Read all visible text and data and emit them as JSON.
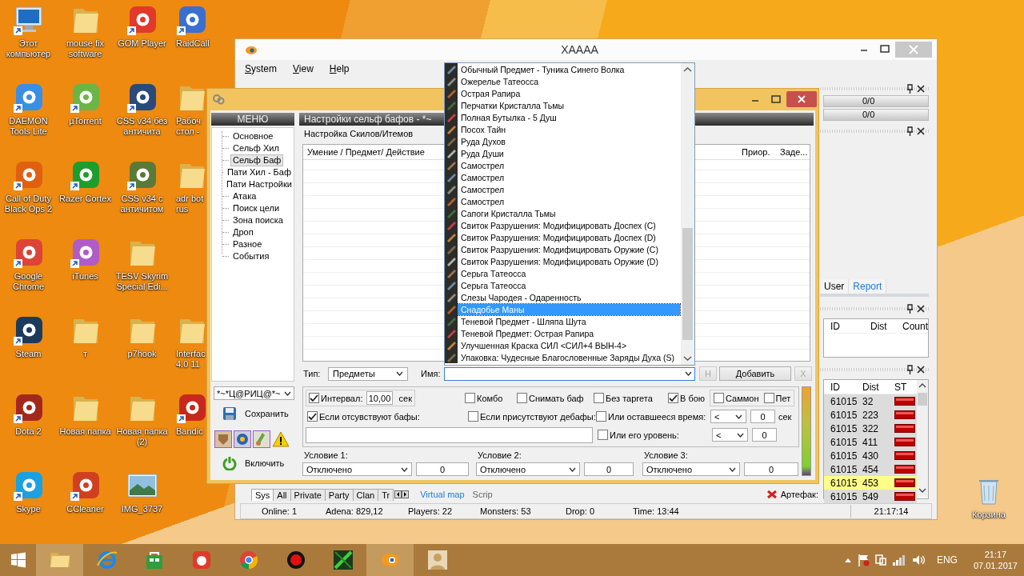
{
  "desktop": {
    "rows": [
      [
        {
          "label": "Этот компьютер",
          "kind": "computer"
        },
        {
          "label": "mouse fix software",
          "kind": "folder"
        },
        {
          "label": "GOM Player",
          "kind": "app",
          "color": "#e2392a"
        },
        {
          "label": "RaidCall",
          "kind": "app",
          "color": "#3a6fd0"
        }
      ],
      [
        {
          "label": "DAEMON Tools Lite",
          "kind": "app",
          "color": "#3a8ee6"
        },
        {
          "label": "µTorrent",
          "kind": "app",
          "color": "#6bb544"
        },
        {
          "label": "CSS v34 без античита",
          "kind": "app",
          "color": "#2a4a7a"
        },
        {
          "label": "Рабоч стол -",
          "kind": "folder"
        }
      ],
      [
        {
          "label": "Call of Duty Black Ops 2",
          "kind": "app",
          "color": "#e06010"
        },
        {
          "label": "Razer Cortex",
          "kind": "app",
          "color": "#1f9c2e"
        },
        {
          "label": "CSS v34 с античитом",
          "kind": "app",
          "color": "#5a7a3a"
        },
        {
          "label": "adr bot rus",
          "kind": "folder"
        }
      ],
      [
        {
          "label": "Google Chrome",
          "kind": "app",
          "color": "#db4437"
        },
        {
          "label": "iTunes",
          "kind": "app",
          "color": "#b05cc8"
        },
        {
          "label": "TESV Skyrim Special Edi...",
          "kind": "folder"
        }
      ],
      [
        {
          "label": "Steam",
          "kind": "app",
          "color": "#1b3a5c"
        },
        {
          "label": "т",
          "kind": "folder"
        },
        {
          "label": "p7hook",
          "kind": "folder"
        },
        {
          "label": "Interfac 4.0 11",
          "kind": "folder"
        }
      ],
      [
        {
          "label": "Dota 2",
          "kind": "app",
          "color": "#a3281c"
        },
        {
          "label": "Новая папка",
          "kind": "folder"
        },
        {
          "label": "Новая папка (2)",
          "kind": "folder"
        },
        {
          "label": "Bandic",
          "kind": "app",
          "color": "#c8281c"
        }
      ],
      [
        {
          "label": "Skype",
          "kind": "app",
          "color": "#1ba1e2"
        },
        {
          "label": "CCleaner",
          "kind": "app",
          "color": "#d04020"
        },
        {
          "label": "IMG_3737",
          "kind": "image"
        }
      ]
    ],
    "recycle_bin": "Корзина"
  },
  "main_window": {
    "title": "XAAAA",
    "menu": [
      "System",
      "View",
      "Help"
    ],
    "bars": [
      "0/0",
      "0/0"
    ],
    "side_tabs": [
      {
        "label": "User",
        "selected": false
      },
      {
        "label": "Report",
        "selected": true
      }
    ],
    "npc_table": {
      "columns": [
        "ID",
        "Dist",
        "Count"
      ]
    },
    "mob_table": {
      "columns": [
        "ID",
        "Dist",
        "ST"
      ],
      "rows": [
        {
          "id": "61015",
          "dist": "32",
          "selected": false
        },
        {
          "id": "61015",
          "dist": "223",
          "selected": false
        },
        {
          "id": "61015",
          "dist": "322",
          "selected": false
        },
        {
          "id": "61015",
          "dist": "411",
          "selected": false
        },
        {
          "id": "61015",
          "dist": "430",
          "selected": false
        },
        {
          "id": "61015",
          "dist": "454",
          "selected": false
        },
        {
          "id": "61015",
          "dist": "453",
          "selected": true
        },
        {
          "id": "61015",
          "dist": "549",
          "selected": false
        }
      ]
    },
    "chat_tabs": [
      {
        "label": "Sys",
        "selected": true
      },
      {
        "label": "All",
        "selected": false
      },
      {
        "label": "Private",
        "selected": false
      },
      {
        "label": "Party",
        "selected": false
      },
      {
        "label": "Clan",
        "selected": false
      },
      {
        "label": "Tr",
        "selected": false
      }
    ],
    "map_tabs": [
      {
        "label": "Virtual map",
        "selected": true
      },
      {
        "label": "Scrip",
        "selected": false
      }
    ],
    "artifact_label": "Артефак:",
    "status_bar": [
      "Online: 1",
      "Adena: 829,12",
      "Players: 22",
      "Monsters: 53",
      "Drop: 0",
      "Time: 13:44",
      "21:17:14"
    ]
  },
  "dialog": {
    "menu_title": "МЕНЮ",
    "nav": [
      {
        "label": "Основное",
        "selected": false
      },
      {
        "label": "Сельф Хил",
        "selected": false
      },
      {
        "label": "Сельф Баф",
        "selected": true
      },
      {
        "label": "Пати Хил - Баф",
        "selected": false
      },
      {
        "label": "Пати Настройки",
        "selected": false
      },
      {
        "label": "Атака",
        "selected": false
      },
      {
        "label": "Поиск цели",
        "selected": false
      },
      {
        "label": "Зона поиска",
        "selected": false
      },
      {
        "label": "Дроп",
        "selected": false
      },
      {
        "label": "Разное",
        "selected": false
      },
      {
        "label": "События",
        "selected": false
      }
    ],
    "profile": "*~*Ц@РИЦ@*~",
    "save": "Сохранить",
    "enable": "Включить",
    "panel_title": "Настройки сельф бафов - *~",
    "group": "Настройка Скилов/Итемов",
    "columns": [
      "Умение / Предмет/ Действие",
      "Приор.",
      "Заде..."
    ],
    "type_label": "Тип:",
    "type_value": "Предметы",
    "name_label": "Имя:",
    "buttons": [
      {
        "label": "Н",
        "disabled": true
      },
      {
        "label": "Добавить",
        "disabled": false
      },
      {
        "label": "X",
        "disabled": true
      }
    ],
    "interval": {
      "label": "Интервал:",
      "checked": true,
      "value": "10,00",
      "unit": "сек"
    },
    "options": [
      {
        "label": "Комбо",
        "checked": false
      },
      {
        "label": "Снимать баф",
        "checked": false
      },
      {
        "label": "Без таргета",
        "checked": false
      },
      {
        "label": "В бою",
        "checked": true
      },
      {
        "label": "Саммон",
        "checked": false
      },
      {
        "label": "Пет",
        "checked": false
      }
    ],
    "buffs_missing": {
      "label": "Если отсувствуют бафы:",
      "checked": true
    },
    "debuffs_present": {
      "label": "Если присутствуют дебафы:",
      "checked": false
    },
    "time_left": {
      "label": "Или оставшееся время:",
      "checked": false,
      "op": "<",
      "value": "0",
      "unit": "сек"
    },
    "its_level": {
      "label": "Или его уровень:",
      "checked": false,
      "op": "<",
      "value": "0"
    },
    "conditions": [
      {
        "label": "Условие 1:",
        "value": "Отключено",
        "number": "0"
      },
      {
        "label": "Условие 2:",
        "value": "Отключено",
        "number": "0"
      },
      {
        "label": "Условие 3:",
        "value": "Отключено",
        "number": "0"
      }
    ]
  },
  "name_list": [
    {
      "label": "Обычный Предмет - Туника Синего Волка",
      "selected": false
    },
    {
      "label": "Ожерелье Татеосса",
      "selected": false
    },
    {
      "label": "Острая Рапира",
      "selected": false
    },
    {
      "label": "Перчатки Кристалла Тьмы",
      "selected": false
    },
    {
      "label": "Полная Бутылка - 5 Душ",
      "selected": false
    },
    {
      "label": "Посох Тайн",
      "selected": false
    },
    {
      "label": "Руда Духов",
      "selected": false
    },
    {
      "label": "Руда Души",
      "selected": false
    },
    {
      "label": "Самострел",
      "selected": false
    },
    {
      "label": "Самострел",
      "selected": false
    },
    {
      "label": "Самострел",
      "selected": false
    },
    {
      "label": "Самострел",
      "selected": false
    },
    {
      "label": "Сапоги Кристалла Тьмы",
      "selected": false
    },
    {
      "label": "Свиток Разрушения: Модифицировать Доспех (C)",
      "selected": false
    },
    {
      "label": "Свиток Разрушения: Модифицировать Доспех (D)",
      "selected": false
    },
    {
      "label": "Свиток Разрушения: Модифицировать Оружие (C)",
      "selected": false
    },
    {
      "label": "Свиток Разрушения: Модифицировать Оружие (D)",
      "selected": false
    },
    {
      "label": "Серьга Татеосса",
      "selected": false
    },
    {
      "label": "Серьга Татеосса",
      "selected": false
    },
    {
      "label": "Слезы Чародея - Одаренность",
      "selected": false
    },
    {
      "label": "Снадобье Маны",
      "selected": true
    },
    {
      "label": "Теневой Предмет - Шляпа Шута",
      "selected": false
    },
    {
      "label": "Теневой Предмет: Острая Рапира",
      "selected": false
    },
    {
      "label": "Улучшенная Краска СИЛ <СИЛ+4 ВЫН-4>",
      "selected": false
    },
    {
      "label": "Упаковка: Чудесные Благословенные Заряды Духа (S)",
      "selected": false
    }
  ],
  "taskbar": {
    "apps": [
      {
        "kind": "folder",
        "active": true
      },
      {
        "kind": "ie",
        "active": false
      },
      {
        "kind": "store",
        "active": false
      },
      {
        "kind": "gom",
        "active": false
      },
      {
        "kind": "chrome",
        "active": false
      },
      {
        "kind": "record",
        "active": false
      },
      {
        "kind": "game",
        "active": false
      },
      {
        "kind": "blender",
        "active": true
      },
      {
        "kind": "portrait",
        "active": false
      }
    ],
    "tray": {
      "language": "ENG",
      "time": "21:17",
      "date": "07.01.2017"
    }
  }
}
